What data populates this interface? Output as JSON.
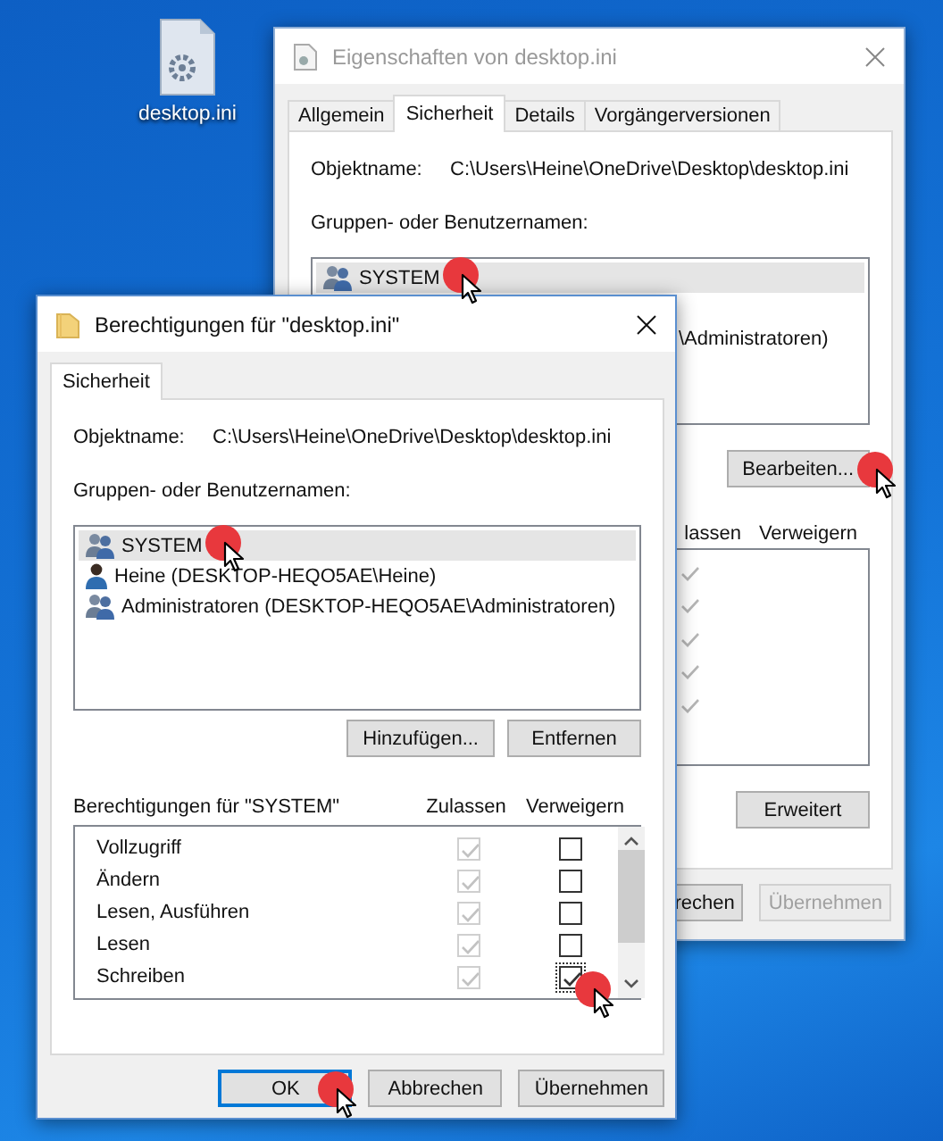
{
  "desktop_icon": {
    "label": "desktop.ini"
  },
  "properties_window": {
    "title": "Eigenschaften von desktop.ini",
    "tabs": [
      {
        "label": "Allgemein",
        "selected": false
      },
      {
        "label": "Sicherheit",
        "selected": true
      },
      {
        "label": "Details",
        "selected": false
      },
      {
        "label": "Vorgängerversionen",
        "selected": false
      }
    ],
    "object_label": "Objektname:",
    "object_path": "C:\\Users\\Heine\\OneDrive\\Desktop\\desktop.ini",
    "groups_label": "Gruppen- oder Benutzernamen:",
    "principals": [
      {
        "name": "SYSTEM",
        "kind": "group",
        "selected": true,
        "clicked": true
      },
      {
        "name": "\\Administratoren)",
        "kind": "partial",
        "selected": false,
        "clicked": false
      }
    ],
    "edit_button": {
      "label": "Bearbeiten...",
      "clicked": true
    },
    "columns": [
      "lassen",
      "Verweigern"
    ],
    "permissions": [
      {
        "allow": true
      },
      {
        "allow": true
      },
      {
        "allow": true
      },
      {
        "allow": true
      },
      {
        "allow": true
      }
    ],
    "advanced_button": {
      "label": "Erweitert"
    },
    "buttons": [
      {
        "label": "rechen",
        "disabled": false
      },
      {
        "label": "Übernehmen",
        "disabled": true
      }
    ]
  },
  "permissions_window": {
    "title": "Berechtigungen für \"desktop.ini\"",
    "tabs": [
      {
        "label": "Sicherheit",
        "selected": true
      }
    ],
    "object_label": "Objektname:",
    "object_path": "C:\\Users\\Heine\\OneDrive\\Desktop\\desktop.ini",
    "groups_label": "Gruppen- oder Benutzernamen:",
    "principals": [
      {
        "name": "SYSTEM",
        "kind": "group",
        "selected": true,
        "clicked": true
      },
      {
        "name": "Heine (DESKTOP-HEQO5AE\\Heine)",
        "kind": "user",
        "selected": false,
        "clicked": false
      },
      {
        "name": "Administratoren (DESKTOP-HEQO5AE\\Administratoren)",
        "kind": "group",
        "selected": false,
        "clicked": false
      }
    ],
    "add_button": "Hinzufügen...",
    "remove_button": "Entfernen",
    "permissions_label": "Berechtigungen für \"SYSTEM\"",
    "columns": [
      "Zulassen",
      "Verweigern"
    ],
    "permissions": [
      {
        "name": "Vollzugriff",
        "allow": true,
        "allow_disabled": true,
        "deny": false,
        "clicked": false
      },
      {
        "name": "Ändern",
        "allow": true,
        "allow_disabled": true,
        "deny": false,
        "clicked": false
      },
      {
        "name": "Lesen, Ausführen",
        "allow": true,
        "allow_disabled": true,
        "deny": false,
        "clicked": false
      },
      {
        "name": "Lesen",
        "allow": true,
        "allow_disabled": true,
        "deny": false,
        "clicked": false
      },
      {
        "name": "Schreiben",
        "allow": true,
        "allow_disabled": true,
        "deny": true,
        "clicked": true
      }
    ],
    "buttons": [
      {
        "label": "OK",
        "default": true,
        "clicked": true
      },
      {
        "label": "Abbrechen",
        "default": false,
        "clicked": false
      },
      {
        "label": "Übernehmen",
        "default": false,
        "clicked": false
      }
    ]
  }
}
